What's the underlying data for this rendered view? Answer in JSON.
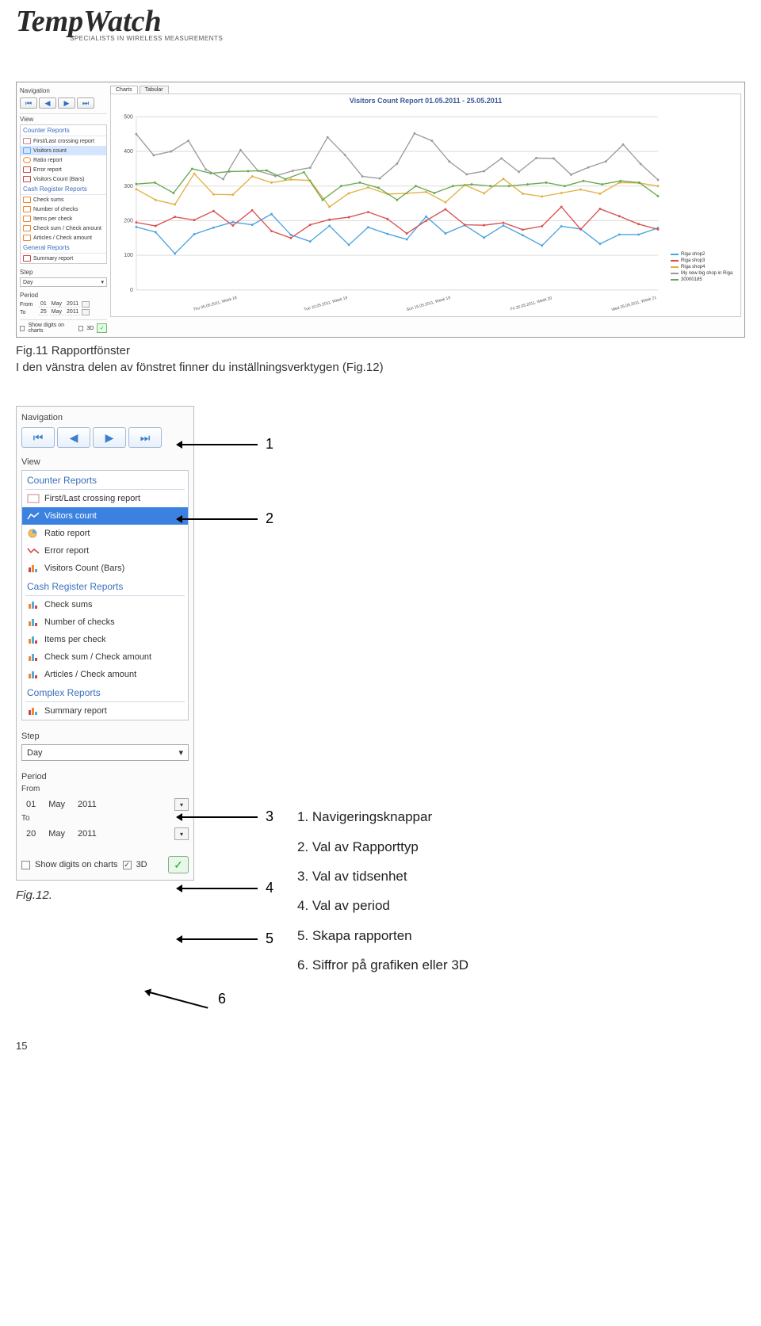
{
  "brand": {
    "name": "TempWatch",
    "tagline": "SPECIALISTS IN WIRELESS MEASUREMENTS"
  },
  "fig1": {
    "nav_label": "Navigation",
    "view_label": "View",
    "tabs": [
      "Charts",
      "Tabular"
    ],
    "chart_title": "Visitors Count Report 01.05.2011 - 25.05.2011",
    "sections": {
      "counter": "Counter Reports",
      "cash": "Cash Register Reports",
      "general": "General Reports"
    },
    "reports": {
      "counter": [
        "First/Last crossing report",
        "Visitors count",
        "Ratio report",
        "Error report",
        "Visitors Count (Bars)"
      ],
      "cash": [
        "Check sums",
        "Number of checks",
        "Items per check",
        "Check sum / Check amount",
        "Articles / Check amount"
      ],
      "general": [
        "Summary report"
      ]
    },
    "selected_report": "Visitors count",
    "step": {
      "label": "Step",
      "value": "Day"
    },
    "period": {
      "label": "Period",
      "from_label": "From",
      "from": [
        "01",
        "May",
        "2011"
      ],
      "to_label": "To",
      "to": [
        "25",
        "May",
        "2011"
      ]
    },
    "show_digits": "Show digits on charts",
    "threed": "3D",
    "legend": [
      "Riga shop2",
      "Riga shop3",
      "Riga shop4",
      "My new big shop in Riga",
      "30000185"
    ],
    "legend_colors": [
      "#4aa3e0",
      "#d94f4f",
      "#e0b040",
      "#9a9a9a",
      "#6aa84f"
    ],
    "x_labels": [
      "Thu 05.05.2011, Week 18",
      "Tue 10.05.2011, Week 19",
      "Sun 15.05.2011, Week 19",
      "Fri 20.05.2011, Week 20",
      "Wed 25.05.2011, Week 21"
    ],
    "y_ticks": [
      "0",
      "100",
      "200",
      "300",
      "400",
      "500"
    ]
  },
  "caption1": "Fig.11 Rapportfönster",
  "body1": "I den vänstra delen av fönstret finner du inställningsverktygen (Fig.12)",
  "fig2": {
    "nav_label": "Navigation",
    "view_label": "View",
    "sections": {
      "counter": "Counter Reports",
      "cash": "Cash Register Reports",
      "complex": "Complex Reports"
    },
    "reports": {
      "counter": [
        "First/Last crossing report",
        "Visitors count",
        "Ratio report",
        "Error report",
        "Visitors Count (Bars)"
      ],
      "cash": [
        "Check sums",
        "Number of checks",
        "Items per check",
        "Check sum / Check amount",
        "Articles / Check amount"
      ],
      "complex": [
        "Summary report"
      ]
    },
    "selected_report": "Visitors count",
    "step": {
      "label": "Step",
      "value": "Day"
    },
    "period": {
      "label": "Period",
      "from_label": "From",
      "from": [
        "01",
        "May",
        "2011"
      ],
      "to_label": "To",
      "to": [
        "20",
        "May",
        "2011"
      ]
    },
    "show_digits": "Show digits on charts",
    "threed": "3D",
    "caption": "Fig.12.",
    "annotations": [
      "1",
      "2",
      "3",
      "4",
      "5",
      "6"
    ],
    "legend": [
      "1. Navigeringsknappar",
      "2. Val av Rapporttyp",
      "3. Val av tidsenhet",
      "4. Val av period",
      "5. Skapa rapporten",
      "6. Siffror på grafiken eller 3D"
    ]
  },
  "page_number": "15",
  "chart_data": {
    "type": "line",
    "title": "Visitors Count Report 01.05.2011 - 25.05.2011",
    "xlabel": "",
    "ylabel": "",
    "ylim": [
      0,
      500
    ],
    "x": [
      1,
      2,
      3,
      4,
      5,
      6,
      7,
      8,
      9,
      10,
      11,
      12,
      13,
      14,
      15,
      16,
      17,
      18,
      19,
      20,
      21,
      22,
      23,
      24,
      25
    ],
    "series": [
      {
        "name": "Riga shop2",
        "color": "#4aa3e0",
        "values": [
          182,
          167,
          105,
          161,
          180,
          196,
          188,
          219,
          159,
          140,
          185,
          130,
          181,
          162,
          146,
          212,
          163,
          187,
          151,
          186,
          158,
          128,
          184,
          176,
          133,
          160,
          160,
          179
        ]
      },
      {
        "name": "Riga shop3",
        "color": "#d94f4f",
        "values": [
          195,
          185,
          211,
          202,
          228,
          186,
          230,
          170,
          150,
          188,
          203,
          210,
          225,
          205,
          163,
          200,
          233,
          188,
          187,
          194,
          174,
          184,
          240,
          175,
          234,
          213,
          190,
          175
        ]
      },
      {
        "name": "Riga shop4",
        "color": "#e0b040",
        "values": [
          291,
          260,
          247,
          336,
          276,
          275,
          328,
          310,
          319,
          316,
          240,
          279,
          296,
          277,
          279,
          283,
          253,
          303,
          279,
          321,
          278,
          270,
          280,
          290,
          278,
          310,
          309,
          300
        ]
      },
      {
        "name": "My new big shop in Riga",
        "color": "#9a9a9a",
        "values": [
          450,
          389,
          400,
          431,
          348,
          320,
          404,
          344,
          329,
          344,
          353,
          441,
          390,
          328,
          322,
          365,
          452,
          431,
          371,
          334,
          343,
          380,
          341,
          381,
          380,
          333,
          354,
          371,
          420,
          364,
          318
        ]
      },
      {
        "name": "30000185",
        "color": "#6aa84f",
        "values": [
          306,
          310,
          280,
          350,
          337,
          342,
          343,
          345,
          320,
          340,
          260,
          300,
          310,
          295,
          260,
          300,
          280,
          300,
          305,
          300,
          300,
          305,
          310,
          300,
          315,
          305,
          315,
          310,
          271
        ]
      }
    ]
  }
}
